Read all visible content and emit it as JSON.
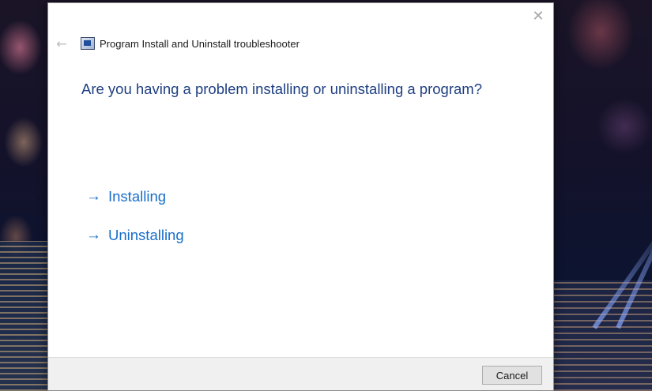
{
  "window": {
    "title": "Program Install and Uninstall troubleshooter",
    "close_symbol": "✕",
    "back_symbol": "←"
  },
  "main": {
    "question": "Are you having a problem installing or uninstalling a program?",
    "options": [
      {
        "label": "Installing",
        "icon": "arrow-right-icon",
        "symbol": "→"
      },
      {
        "label": "Uninstalling",
        "icon": "arrow-right-icon",
        "symbol": "→"
      }
    ]
  },
  "footer": {
    "cancel_label": "Cancel"
  },
  "colors": {
    "question_text": "#1e3f82",
    "link_text": "#1a6fc9",
    "footer_bg": "#f0f0f0"
  }
}
